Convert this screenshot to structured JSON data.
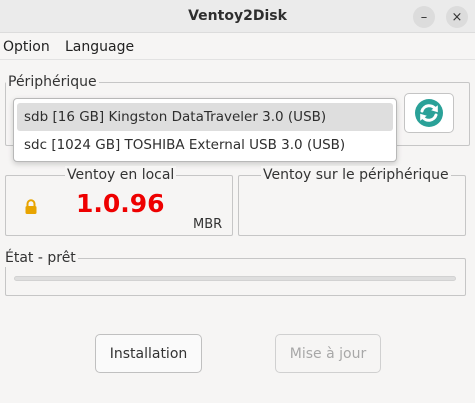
{
  "window": {
    "title": "Ventoy2Disk",
    "minimize_glyph": "–",
    "close_glyph": "×"
  },
  "menu": {
    "items": [
      "Option",
      "Language"
    ]
  },
  "device_group": {
    "label": "Périphérique",
    "dropdown_items": [
      {
        "label": "sdb  [16 GB]  Kingston DataTraveler 3.0 (USB)",
        "selected": true
      },
      {
        "label": "sdc  [1024 GB]  TOSHIBA External USB 3.0 (USB)",
        "selected": false
      }
    ],
    "refresh_icon": "refresh-icon",
    "refresh_color": "#2aa198"
  },
  "local_group": {
    "label": "Ventoy en local",
    "version": "1.0.96",
    "version_color": "#ee0000",
    "partition_style": "MBR",
    "lock_icon": "lock-icon",
    "lock_color": "#e8a400"
  },
  "device_ventoy_group": {
    "label": "Ventoy sur le périphérique",
    "version": ""
  },
  "status_group": {
    "label": "État - prêt",
    "progress": 0
  },
  "buttons": {
    "install": "Installation",
    "update": "Mise à jour"
  }
}
